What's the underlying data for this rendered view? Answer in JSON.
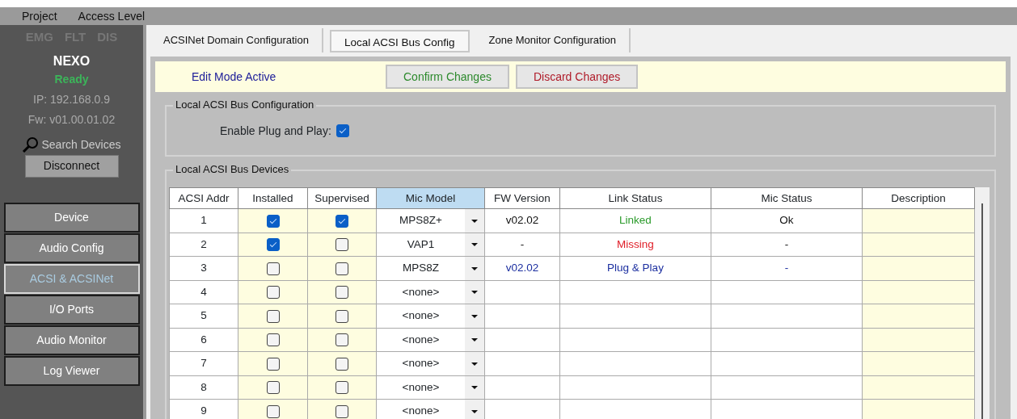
{
  "menu": [
    "Project",
    "Access Level"
  ],
  "sidebar": {
    "indicators": [
      "EMG",
      "FLT",
      "DIS"
    ],
    "device_name": "NEXO",
    "status": "Ready",
    "ip": "IP: 192.168.0.9",
    "firmware": "Fw: v01.00.01.02",
    "search": "Search Devices",
    "disconnect": "Disconnect",
    "nav": [
      {
        "label": "Device",
        "selected": false
      },
      {
        "label": "Audio Config",
        "selected": false
      },
      {
        "label": "ACSI & ACSINet",
        "selected": true
      },
      {
        "label": "I/O Ports",
        "selected": false
      },
      {
        "label": "Audio Monitor",
        "selected": false
      },
      {
        "label": "Log Viewer",
        "selected": false
      }
    ]
  },
  "tabs": [
    {
      "label": "ACSINet Domain Configuration",
      "selected": false
    },
    {
      "label": "Local ACSI Bus Config",
      "selected": true
    },
    {
      "label": "Zone Monitor Configuration",
      "selected": false
    }
  ],
  "edit_bar": {
    "message": "Edit Mode Active",
    "buttons": [
      {
        "label": "Confirm Changes",
        "kind": "confirm"
      },
      {
        "label": "Discard Changes",
        "kind": "discard"
      }
    ]
  },
  "config_group": {
    "title": "Local ACSI Bus Configuration",
    "plug_and_play": {
      "label": "Enable Plug and Play:",
      "checked": true
    }
  },
  "devices_group": {
    "title": "Local ACSI Bus Devices",
    "columns": [
      "ACSI Addr",
      "Installed",
      "Supervised",
      "Mic Model",
      "FW Version",
      "Link Status",
      "Mic Status",
      "Description"
    ],
    "rows": [
      {
        "addr": "1",
        "installed": true,
        "supervised": true,
        "mic_model": "MPS8Z+",
        "fw": "v02.02",
        "link_status": "Linked",
        "mic_status": "Ok",
        "kind": "linked"
      },
      {
        "addr": "2",
        "installed": true,
        "supervised": false,
        "mic_model": "VAP1",
        "fw": "-",
        "link_status": "Missing",
        "mic_status": "-",
        "kind": "missing"
      },
      {
        "addr": "3",
        "installed": false,
        "supervised": false,
        "mic_model": "MPS8Z",
        "fw": "v02.02",
        "link_status": "Plug & Play",
        "mic_status": "-",
        "kind": "plugplay"
      },
      {
        "addr": "4",
        "installed": false,
        "supervised": false,
        "mic_model": "<none>",
        "kind": "empty"
      },
      {
        "addr": "5",
        "installed": false,
        "supervised": false,
        "mic_model": "<none>",
        "kind": "empty"
      },
      {
        "addr": "6",
        "installed": false,
        "supervised": false,
        "mic_model": "<none>",
        "kind": "empty"
      },
      {
        "addr": "7",
        "installed": false,
        "supervised": false,
        "mic_model": "<none>",
        "kind": "empty"
      },
      {
        "addr": "8",
        "installed": false,
        "supervised": false,
        "mic_model": "<none>",
        "kind": "empty"
      },
      {
        "addr": "9",
        "installed": false,
        "supervised": false,
        "mic_model": "<none>",
        "kind": "empty"
      }
    ]
  }
}
